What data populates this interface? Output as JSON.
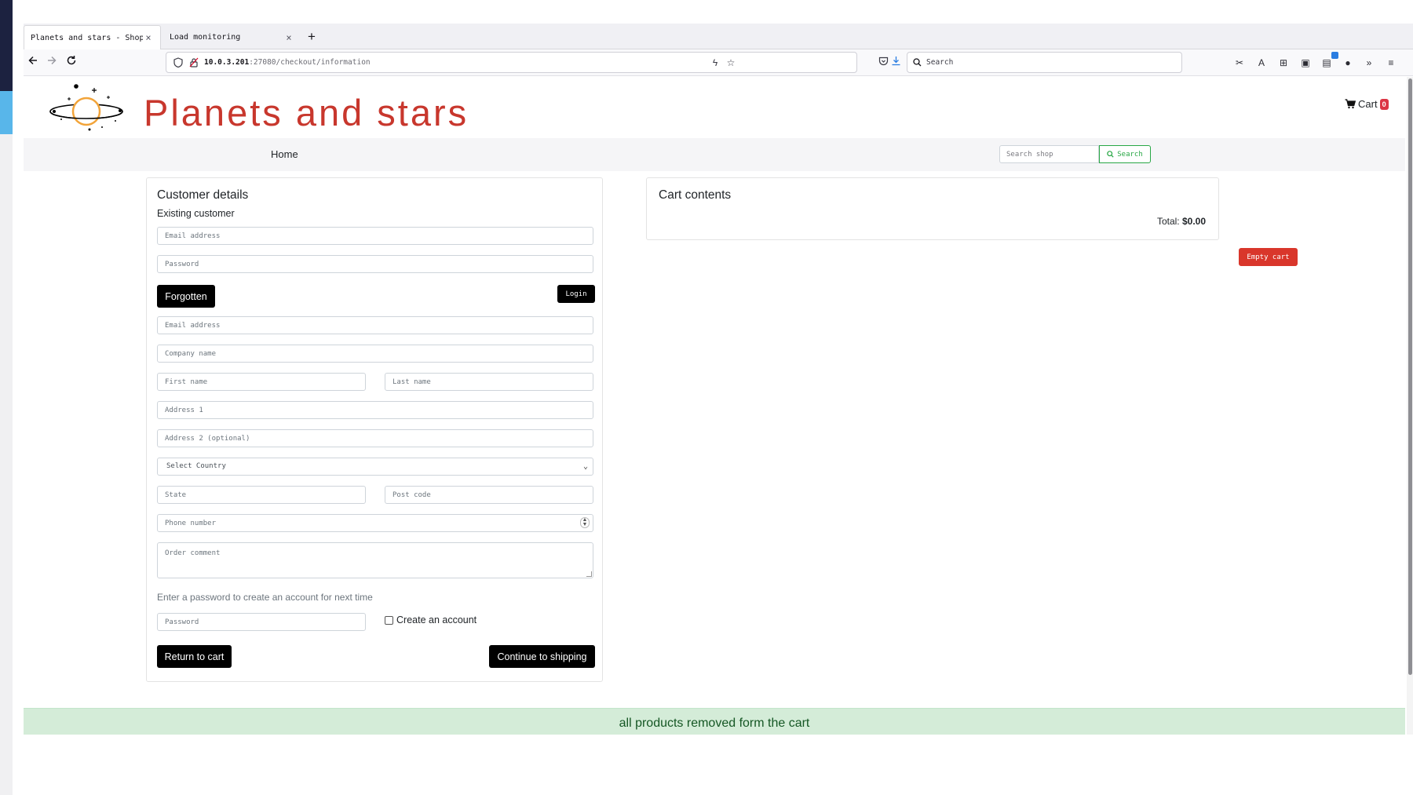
{
  "browser": {
    "tabs": [
      {
        "title": "Planets and stars - Shop",
        "close": "×"
      },
      {
        "title": "Load monitoring",
        "close": "×"
      }
    ],
    "new_tab": "+",
    "url": {
      "host": "10.0.3.201",
      "path": ":27080/checkout/information"
    },
    "search_placeholder": "Search"
  },
  "site": {
    "title": "Planets and stars",
    "cart_label": "Cart",
    "cart_count": "0",
    "nav": {
      "home": "Home"
    },
    "search": {
      "placeholder": "Search shop",
      "button": "Search"
    }
  },
  "customer": {
    "title": "Customer details",
    "existing_title": "Existing customer",
    "login_email_placeholder": "Email address",
    "login_password_placeholder": "Password",
    "forgotten_button": "Forgotten",
    "login_button": "Login",
    "email_placeholder": "Email address",
    "company_placeholder": "Company name",
    "first_name_placeholder": "First name",
    "last_name_placeholder": "Last name",
    "address1_placeholder": "Address 1",
    "address2_placeholder": "Address 2 (optional)",
    "country_selected": "Select Country",
    "state_placeholder": "State",
    "postcode_placeholder": "Post code",
    "phone_placeholder": "Phone number",
    "comment_placeholder": "Order comment",
    "create_account_hint": "Enter a password to create an account for next time",
    "new_password_placeholder": "Password",
    "create_account_label": "Create an account",
    "return_button": "Return to cart",
    "continue_button": "Continue to shipping"
  },
  "cart": {
    "title": "Cart contents",
    "total_label": "Total:",
    "total_value": "$0.00",
    "empty_button": "Empty cart"
  },
  "alert": {
    "message": "all products removed form the cart"
  }
}
